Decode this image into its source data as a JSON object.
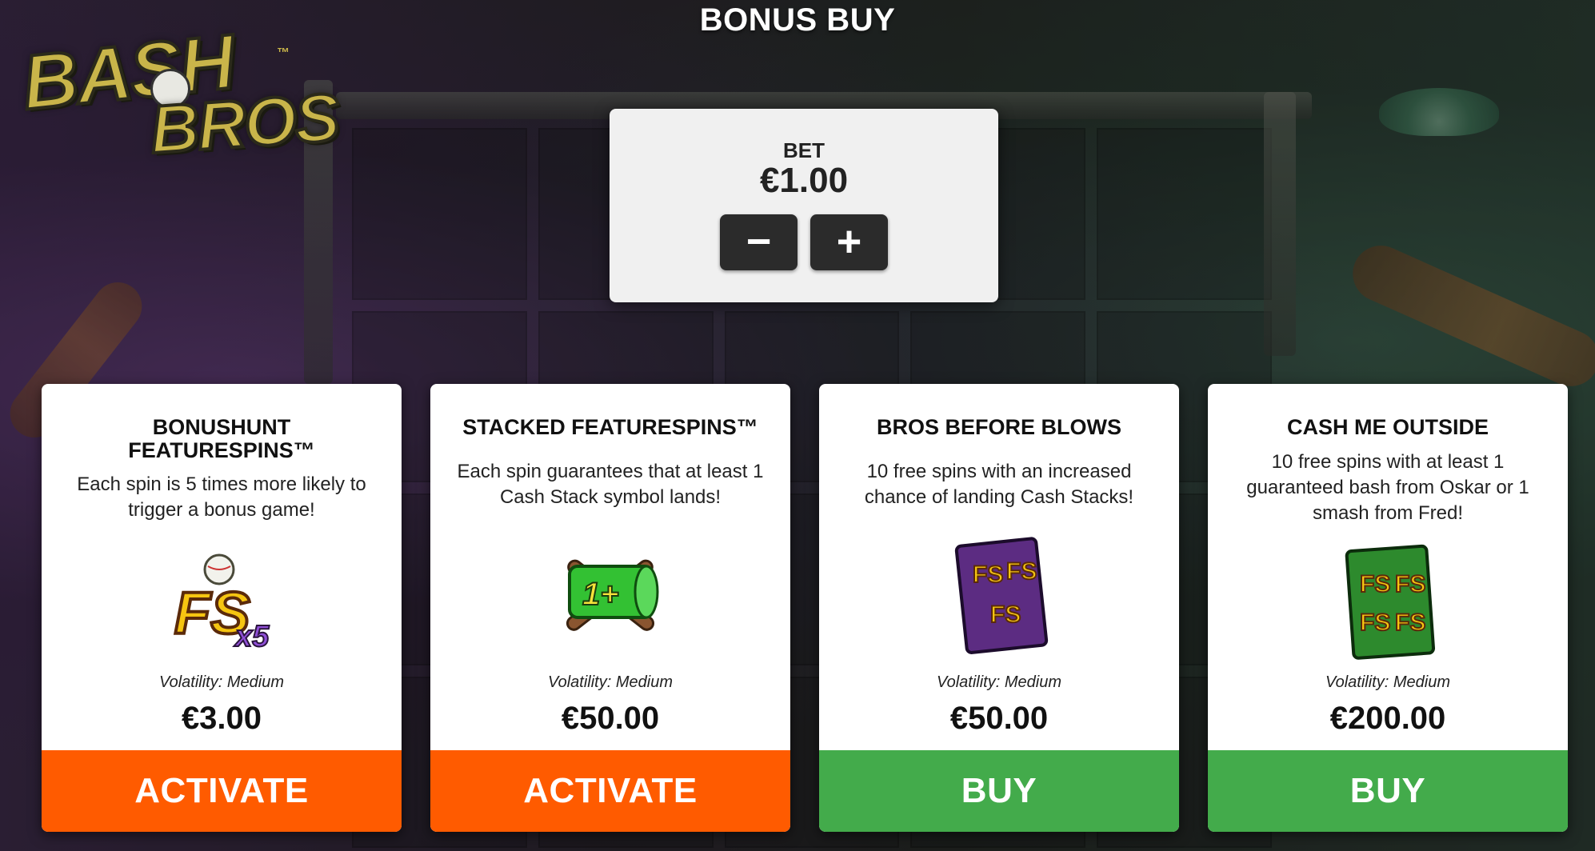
{
  "header": {
    "title": "BONUS BUY",
    "logo_text_line1": "BASH",
    "logo_text_line2": "BROS",
    "logo_tm": "™"
  },
  "bet": {
    "label": "BET",
    "value": "€1.00",
    "decrease_label": "−",
    "increase_label": "+"
  },
  "cards": [
    {
      "title": "BONUSHUNT FEATURESPINS™",
      "description": "Each spin is 5 times more likely to trigger a bonus game!",
      "icon": "fs-x5-icon",
      "icon_text": "FS",
      "icon_sub": "x5",
      "volatility": "Volatility: Medium",
      "price": "€3.00",
      "action_label": "ACTIVATE",
      "action_color": "#ff5b00"
    },
    {
      "title": "STACKED FEATURESPINS™",
      "description": "Each spin guarantees that at least 1 Cash Stack symbol lands!",
      "icon": "cash-stack-bats-icon",
      "icon_text": "1+",
      "volatility": "Volatility: Medium",
      "price": "€50.00",
      "action_label": "ACTIVATE",
      "action_color": "#ff5b00"
    },
    {
      "title": "BROS BEFORE BLOWS",
      "description": "10 free spins with an increased chance of landing Cash Stacks!",
      "icon": "purple-fs-card-icon",
      "icon_text": "FS",
      "volatility": "Volatility: Medium",
      "price": "€50.00",
      "action_label": "BUY",
      "action_color": "#43ab4b"
    },
    {
      "title": "CASH ME OUTSIDE",
      "description": "10 free spins with at least 1 guaranteed bash from Oskar or 1 smash from Fred!",
      "icon": "green-fs-card-icon",
      "icon_text": "FS",
      "volatility": "Volatility: Medium",
      "price": "€200.00",
      "action_label": "BUY",
      "action_color": "#43ab4b"
    }
  ]
}
